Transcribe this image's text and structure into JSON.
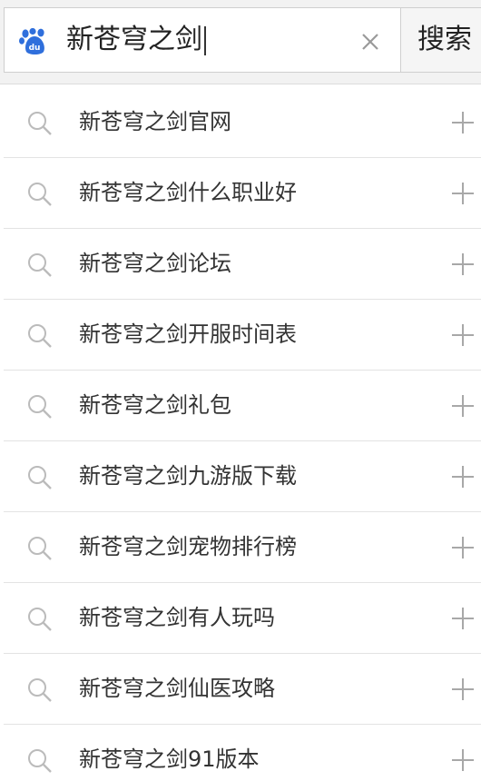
{
  "search": {
    "query": "新苍穹之剑",
    "button_label": "搜索"
  },
  "icons": {
    "logo": "baidu-paw-icon",
    "clear": "close-icon",
    "suggestion": "search-icon",
    "fill": "plus-icon"
  },
  "colors": {
    "brand_blue": "#2f6fdc",
    "icon_gray": "#b5b5b5"
  },
  "suggestions": [
    {
      "label": "新苍穹之剑官网"
    },
    {
      "label": "新苍穹之剑什么职业好"
    },
    {
      "label": "新苍穹之剑论坛"
    },
    {
      "label": "新苍穹之剑开服时间表"
    },
    {
      "label": "新苍穹之剑礼包"
    },
    {
      "label": "新苍穹之剑九游版下载"
    },
    {
      "label": "新苍穹之剑宠物排行榜"
    },
    {
      "label": "新苍穹之剑有人玩吗"
    },
    {
      "label": "新苍穹之剑仙医攻略"
    },
    {
      "label": "新苍穹之剑91版本"
    }
  ]
}
